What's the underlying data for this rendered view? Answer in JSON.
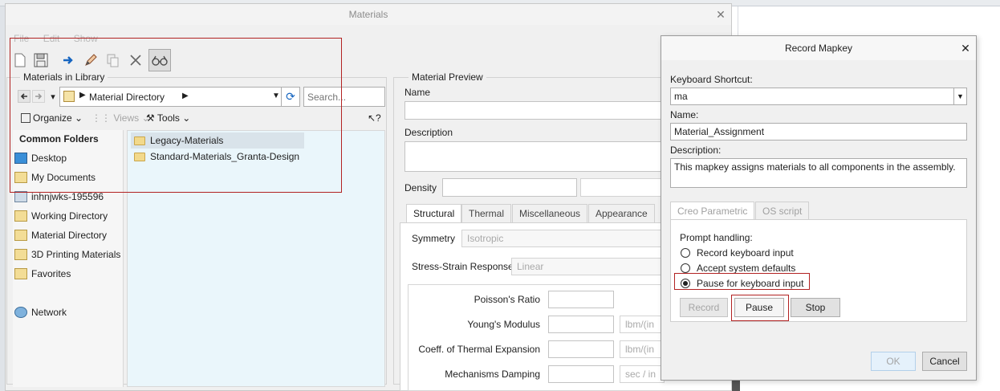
{
  "materials_window": {
    "title": "Materials",
    "menu": [
      "File",
      "Edit",
      "Show"
    ],
    "library_group_label": "Materials in Library",
    "address": "Material Directory",
    "search_placeholder": "Search...",
    "organize_label": "Organize",
    "views_label": "Views",
    "tools_label": "Tools",
    "common_folders_header": "Common Folders",
    "common_folders": [
      "Desktop",
      "My Documents",
      "inhnjwks-195596",
      "Working Directory",
      "Material Directory",
      "3D Printing Materials",
      "Favorites"
    ],
    "network_label": "Network",
    "folder_list": [
      "Legacy-Materials",
      "Standard-Materials_Granta-Design"
    ],
    "preview": {
      "group_label": "Material Preview",
      "name_label": "Name",
      "description_label": "Description",
      "density_label": "Density",
      "tabs": [
        "Structural",
        "Thermal",
        "Miscellaneous",
        "Appearance"
      ],
      "symmetry_label": "Symmetry",
      "symmetry_value": "Isotropic",
      "stress_strain_label": "Stress-Strain Response",
      "stress_strain_value": "Linear",
      "properties": [
        {
          "label": "Poisson's Ratio",
          "unit": ""
        },
        {
          "label": "Young's Modulus",
          "unit": "lbm/(in"
        },
        {
          "label": "Coeff. of Thermal Expansion",
          "unit": "lbm/(in"
        },
        {
          "label": "Mechanisms Damping",
          "unit": "sec / in"
        }
      ]
    }
  },
  "record_mapkey": {
    "title": "Record Mapkey",
    "shortcut_label": "Keyboard Shortcut:",
    "shortcut_value": "ma",
    "name_label": "Name:",
    "name_value": "Material_Assignment",
    "description_label": "Description:",
    "description_value": "This mapkey assigns materials to all components in the assembly.",
    "tabs": [
      "Creo Parametric",
      "OS script"
    ],
    "prompt_label": "Prompt handling:",
    "options": [
      "Record keyboard input",
      "Accept system defaults",
      "Pause for keyboard input"
    ],
    "selected_option": "Pause for keyboard input",
    "buttons": {
      "record": "Record",
      "pause": "Pause",
      "stop": "Stop",
      "ok": "OK",
      "cancel": "Cancel"
    }
  },
  "colors": {
    "highlight": "#b22222",
    "accent": "#1665c0"
  }
}
